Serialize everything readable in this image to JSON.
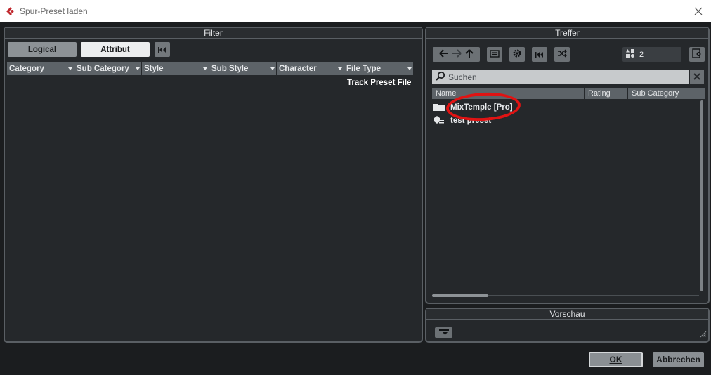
{
  "window": {
    "title": "Spur-Preset laden"
  },
  "filter": {
    "header": "Filter",
    "mode_buttons": [
      "Logical",
      "Attribut"
    ],
    "columns": [
      "Category",
      "Sub Category",
      "Style",
      "Sub Style",
      "Character",
      "File Type"
    ],
    "file_type_value": "Track Preset File"
  },
  "treffer": {
    "header": "Treffer",
    "result_count": "2",
    "search_placeholder": "Suchen",
    "columns": [
      "Name",
      "Rating",
      "Sub Category"
    ],
    "rows": [
      {
        "name": "MixTemple [Pro]",
        "icon": "folder-icon"
      },
      {
        "name": "test preset",
        "icon": "preset-icon"
      }
    ]
  },
  "vorschau": {
    "header": "Vorschau"
  },
  "footer": {
    "ok_label": "OK",
    "cancel_label": "Abbrechen"
  },
  "colors": {
    "accent_red": "#e01313",
    "panel_bg": "#25282b",
    "panel_border": "#5a5f64"
  }
}
